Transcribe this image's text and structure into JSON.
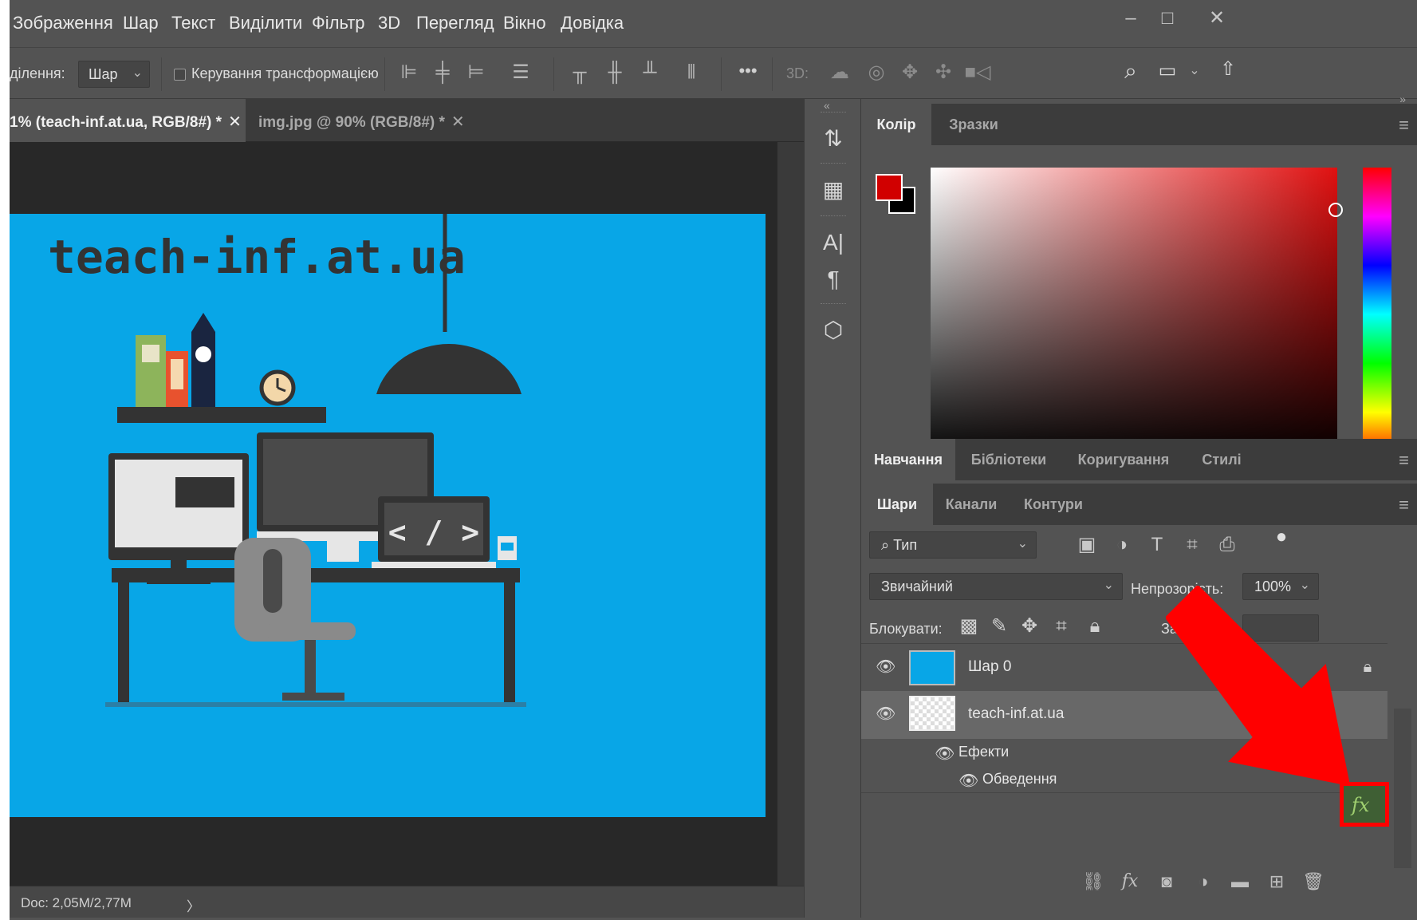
{
  "menu": {
    "items": [
      "Зображення",
      "Шар",
      "Текст",
      "Виділити",
      "Фільтр",
      "3D",
      "Перегляд",
      "Вікно",
      "Довідка"
    ]
  },
  "window_controls": {
    "minimize": "–",
    "maximize": "□",
    "close": "✕"
  },
  "options_bar": {
    "selection_label": "ділення:",
    "layer_select": "Шар",
    "transform_label": "Керування трансформацією",
    "threed_label": "3D:"
  },
  "doc_tabs": [
    {
      "label": "1% (teach-inf.at.ua, RGB/8#) *",
      "close": "✕"
    },
    {
      "label": "img.jpg @ 90% (RGB/8#) *",
      "close": "✕"
    }
  ],
  "canvas": {
    "headline": "teach-inf.at.ua",
    "laptop_code": "< / >",
    "background_color": "#08a6e7"
  },
  "status": {
    "doc": "Doc: 2,05M/2,77M",
    "arrow": "〉"
  },
  "color_panel": {
    "tabs": [
      "Колір",
      "Зразки"
    ],
    "foreground": "#d10000",
    "background": "#000000"
  },
  "learn_panel": {
    "tabs": [
      "Навчання",
      "Бібліотеки",
      "Коригування",
      "Стилі"
    ]
  },
  "layers_panel": {
    "tabs": [
      "Шари",
      "Канали",
      "Контури"
    ],
    "filter_type": "Тип",
    "blend_mode": "Звичайний",
    "opacity_label": "Непрозорість:",
    "opacity_value": "100%",
    "lock_label": "Блокувати:",
    "fill_label": "Заливка:",
    "layers": [
      {
        "name": "Шар 0"
      },
      {
        "name": "teach-inf.at.ua",
        "fx": "fx"
      }
    ],
    "effects_label": "Ефекти",
    "stroke_label": "Обведення"
  }
}
